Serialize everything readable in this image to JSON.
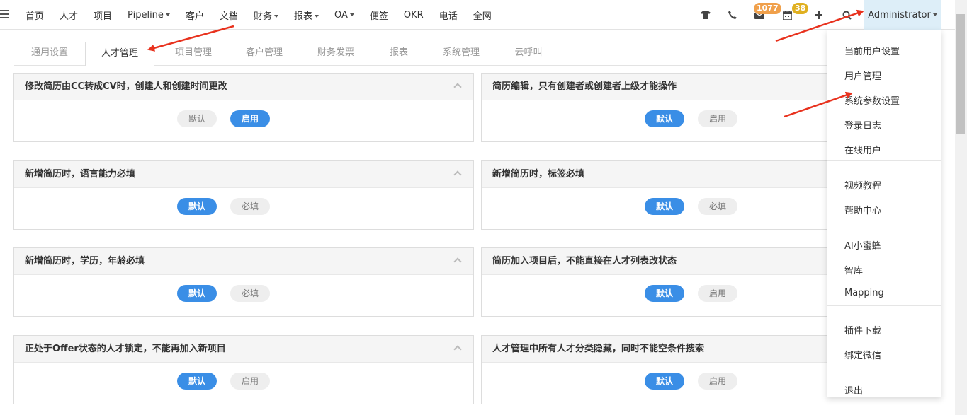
{
  "nav": {
    "items": [
      {
        "label": "首页",
        "caret": false
      },
      {
        "label": "人才",
        "caret": false
      },
      {
        "label": "项目",
        "caret": false
      },
      {
        "label": "Pipeline",
        "caret": true
      },
      {
        "label": "客户",
        "caret": false
      },
      {
        "label": "文档",
        "caret": false
      },
      {
        "label": "财务",
        "caret": true
      },
      {
        "label": "报表",
        "caret": true
      },
      {
        "label": "OA",
        "caret": true
      },
      {
        "label": "便签",
        "caret": false
      },
      {
        "label": "OKR",
        "caret": false
      },
      {
        "label": "电话",
        "caret": false
      },
      {
        "label": "全网",
        "caret": false
      }
    ],
    "mail_badge": "1077",
    "calendar_badge": "38",
    "user_label": "Administrator"
  },
  "colors": {
    "primary": "#3a8ee6",
    "mail_badge": "#f0a04b",
    "calendar_badge": "#e0b020",
    "arrow": "#e8321e"
  },
  "tabs": [
    "通用设置",
    "人才管理",
    "项目管理",
    "客户管理",
    "财务发票",
    "报表",
    "系统管理",
    "云呼叫"
  ],
  "active_tab": "人才管理",
  "cards": [
    {
      "title": "修改简历由CC转成CV时，创建人和创建时间更改",
      "left": "默认",
      "right": "启用",
      "selected": "right",
      "collapse": true
    },
    {
      "title": "简历编辑，只有创建者或创建者上级才能操作",
      "left": "默认",
      "right": "启用",
      "selected": "left",
      "collapse": false
    },
    {
      "title": "新增简历时，语言能力必填",
      "left": "默认",
      "right": "必填",
      "selected": "left",
      "collapse": true
    },
    {
      "title": "新增简历时，标签必填",
      "left": "默认",
      "right": "必填",
      "selected": "left",
      "collapse": false
    },
    {
      "title": "新增简历时，学历，年龄必填",
      "left": "默认",
      "right": "必填",
      "selected": "left",
      "collapse": true
    },
    {
      "title": "简历加入项目后，不能直接在人才列表改状态",
      "left": "默认",
      "right": "启用",
      "selected": "left",
      "collapse": false
    },
    {
      "title": "正处于Offer状态的人才锁定，不能再加入新项目",
      "left": "默认",
      "right": "启用",
      "selected": "left",
      "collapse": true
    },
    {
      "title": "人才管理中所有人才分类隐藏，同时不能空条件搜索",
      "left": "默认",
      "right": "启用",
      "selected": "left",
      "collapse": false
    }
  ],
  "menu": {
    "groups": [
      [
        "当前用户设置",
        "用户管理",
        "系统参数设置",
        "登录日志",
        "在线用户"
      ],
      [
        "视频教程",
        "帮助中心"
      ],
      [
        "AI小蜜蜂",
        "智库",
        "Mapping"
      ],
      [
        "插件下载",
        "绑定微信"
      ],
      [
        "退出"
      ]
    ]
  },
  "icons": {
    "menu": "hamburger-icon",
    "shirt": "shirt-icon",
    "phone": "phone-icon",
    "mail": "mail-icon",
    "calendar": "calendar-icon",
    "plus": "plus-icon",
    "search": "search-icon"
  }
}
